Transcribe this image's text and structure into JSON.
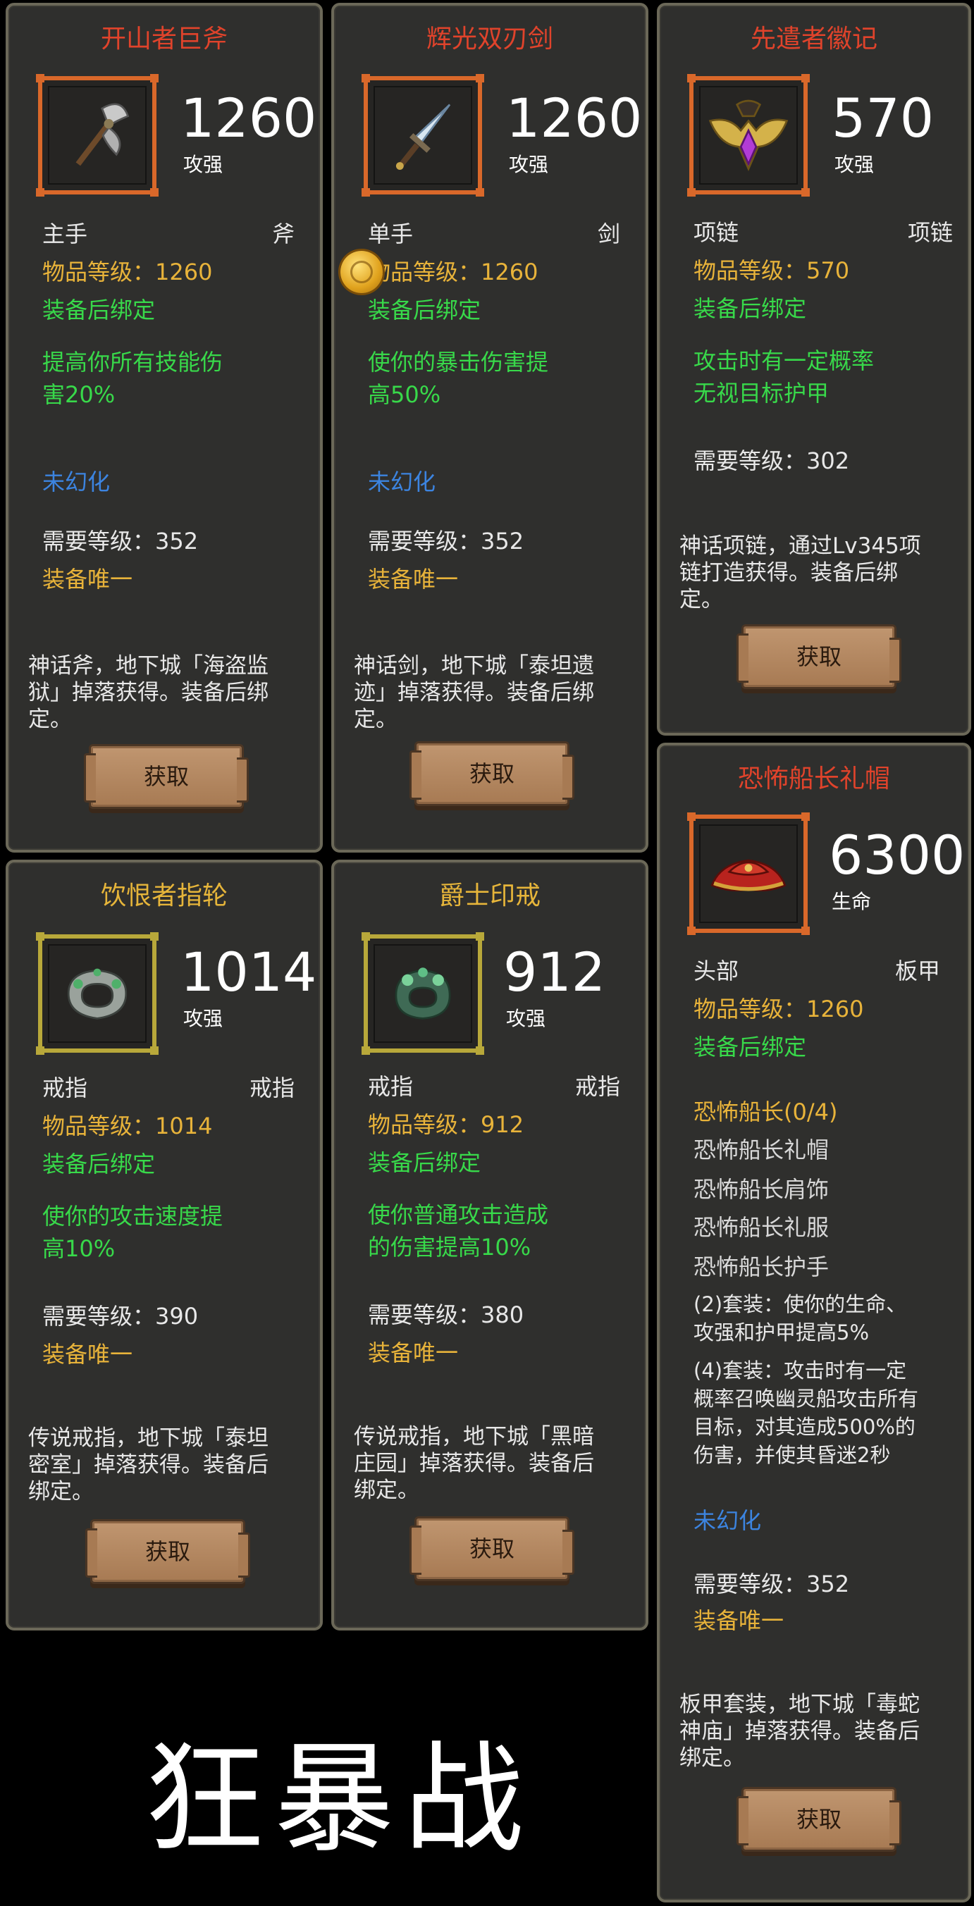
{
  "cards": [
    {
      "title": "开山者巨斧",
      "stat": "1260",
      "stat_label": "攻强",
      "slot": "主手",
      "type": "斧",
      "item_level": "物品等级：1260",
      "bind": "装备后绑定",
      "effect_1": "提高你所有技能伤",
      "effect_2": "害20%",
      "transmog": "未幻化",
      "required_level": "需要等级：352",
      "unique": "装备唯一",
      "desc_1": "神话斧，地下城「海盗监",
      "desc_2": "狱」掉落获得。装备后绑",
      "desc_3": "定。",
      "button": "获取",
      "icon": "axe-icon"
    },
    {
      "title": "辉光双刃剑",
      "stat": "1260",
      "stat_label": "攻强",
      "slot": "单手",
      "type": "剑",
      "item_level": "物品等级：1260",
      "bind": "装备后绑定",
      "effect_1": "使你的暴击伤害提",
      "effect_2": "高50%",
      "transmog": "未幻化",
      "required_level": "需要等级：352",
      "unique": "装备唯一",
      "desc_1": "神话剑，地下城「泰坦遗",
      "desc_2": "迹」掉落获得。装备后绑",
      "desc_3": "定。",
      "button": "获取",
      "icon": "sword-icon"
    },
    {
      "title": "先遣者徽记",
      "stat": "570",
      "stat_label": "攻强",
      "slot": "项链",
      "type": "项链",
      "item_level": "物品等级：570",
      "bind": "装备后绑定",
      "effect_1": "攻击时有一定概率",
      "effect_2": "无视目标护甲",
      "required_level": "需要等级：302",
      "desc_1": "神话项链，通过Lv345项",
      "desc_2": "链打造获得。装备后绑",
      "desc_3": "定。",
      "button": "获取",
      "icon": "amulet-icon"
    },
    {
      "title": "饮恨者指轮",
      "stat": "1014",
      "stat_label": "攻强",
      "slot": "戒指",
      "type": "戒指",
      "item_level": "物品等级：1014",
      "bind": "装备后绑定",
      "effect_1": "使你的攻击速度提",
      "effect_2": "高10%",
      "required_level": "需要等级：390",
      "unique": "装备唯一",
      "desc_1": "传说戒指，地下城「泰坦",
      "desc_2": "密室」掉落获得。装备后",
      "desc_3": "绑定。",
      "button": "获取",
      "icon": "ring-icon"
    },
    {
      "title": "爵士印戒",
      "stat": "912",
      "stat_label": "攻强",
      "slot": "戒指",
      "type": "戒指",
      "item_level": "物品等级：912",
      "bind": "装备后绑定",
      "effect_1": "使你普通攻击造成",
      "effect_2": "的伤害提高10%",
      "required_level": "需要等级：380",
      "unique": "装备唯一",
      "desc_1": "传说戒指，地下城「黑暗",
      "desc_2": "庄园」掉落获得。装备后",
      "desc_3": "绑定。",
      "button": "获取",
      "icon": "signet-ring-icon"
    },
    {
      "title": "恐怖船长礼帽",
      "stat": "6300",
      "stat_label": "生命",
      "slot": "头部",
      "type": "板甲",
      "item_level": "物品等级：1260",
      "bind": "装备后绑定",
      "set_name": "恐怖船长(0/4)",
      "set_items": [
        "恐怖船长礼帽",
        "恐怖船长肩饰",
        "恐怖船长礼服",
        "恐怖船长护手"
      ],
      "set_bonus_2_a": "(2)套装：使你的生命、",
      "set_bonus_2_b": "攻强和护甲提高5%",
      "set_bonus_4_a": "(4)套装：攻击时有一定",
      "set_bonus_4_b": "概率召唤幽灵船攻击所有",
      "set_bonus_4_c": "目标，对其造成500%的",
      "set_bonus_4_d": "伤害，并使其昏迷2秒",
      "transmog": "未幻化",
      "required_level": "需要等级：352",
      "unique": "装备唯一",
      "desc_1": "板甲套装，地下城「毒蛇",
      "desc_2": "神庙」掉落获得。装备后",
      "desc_3": "绑定。",
      "button": "获取",
      "icon": "tricorn-hat-icon"
    }
  ],
  "class_title": "狂暴战"
}
